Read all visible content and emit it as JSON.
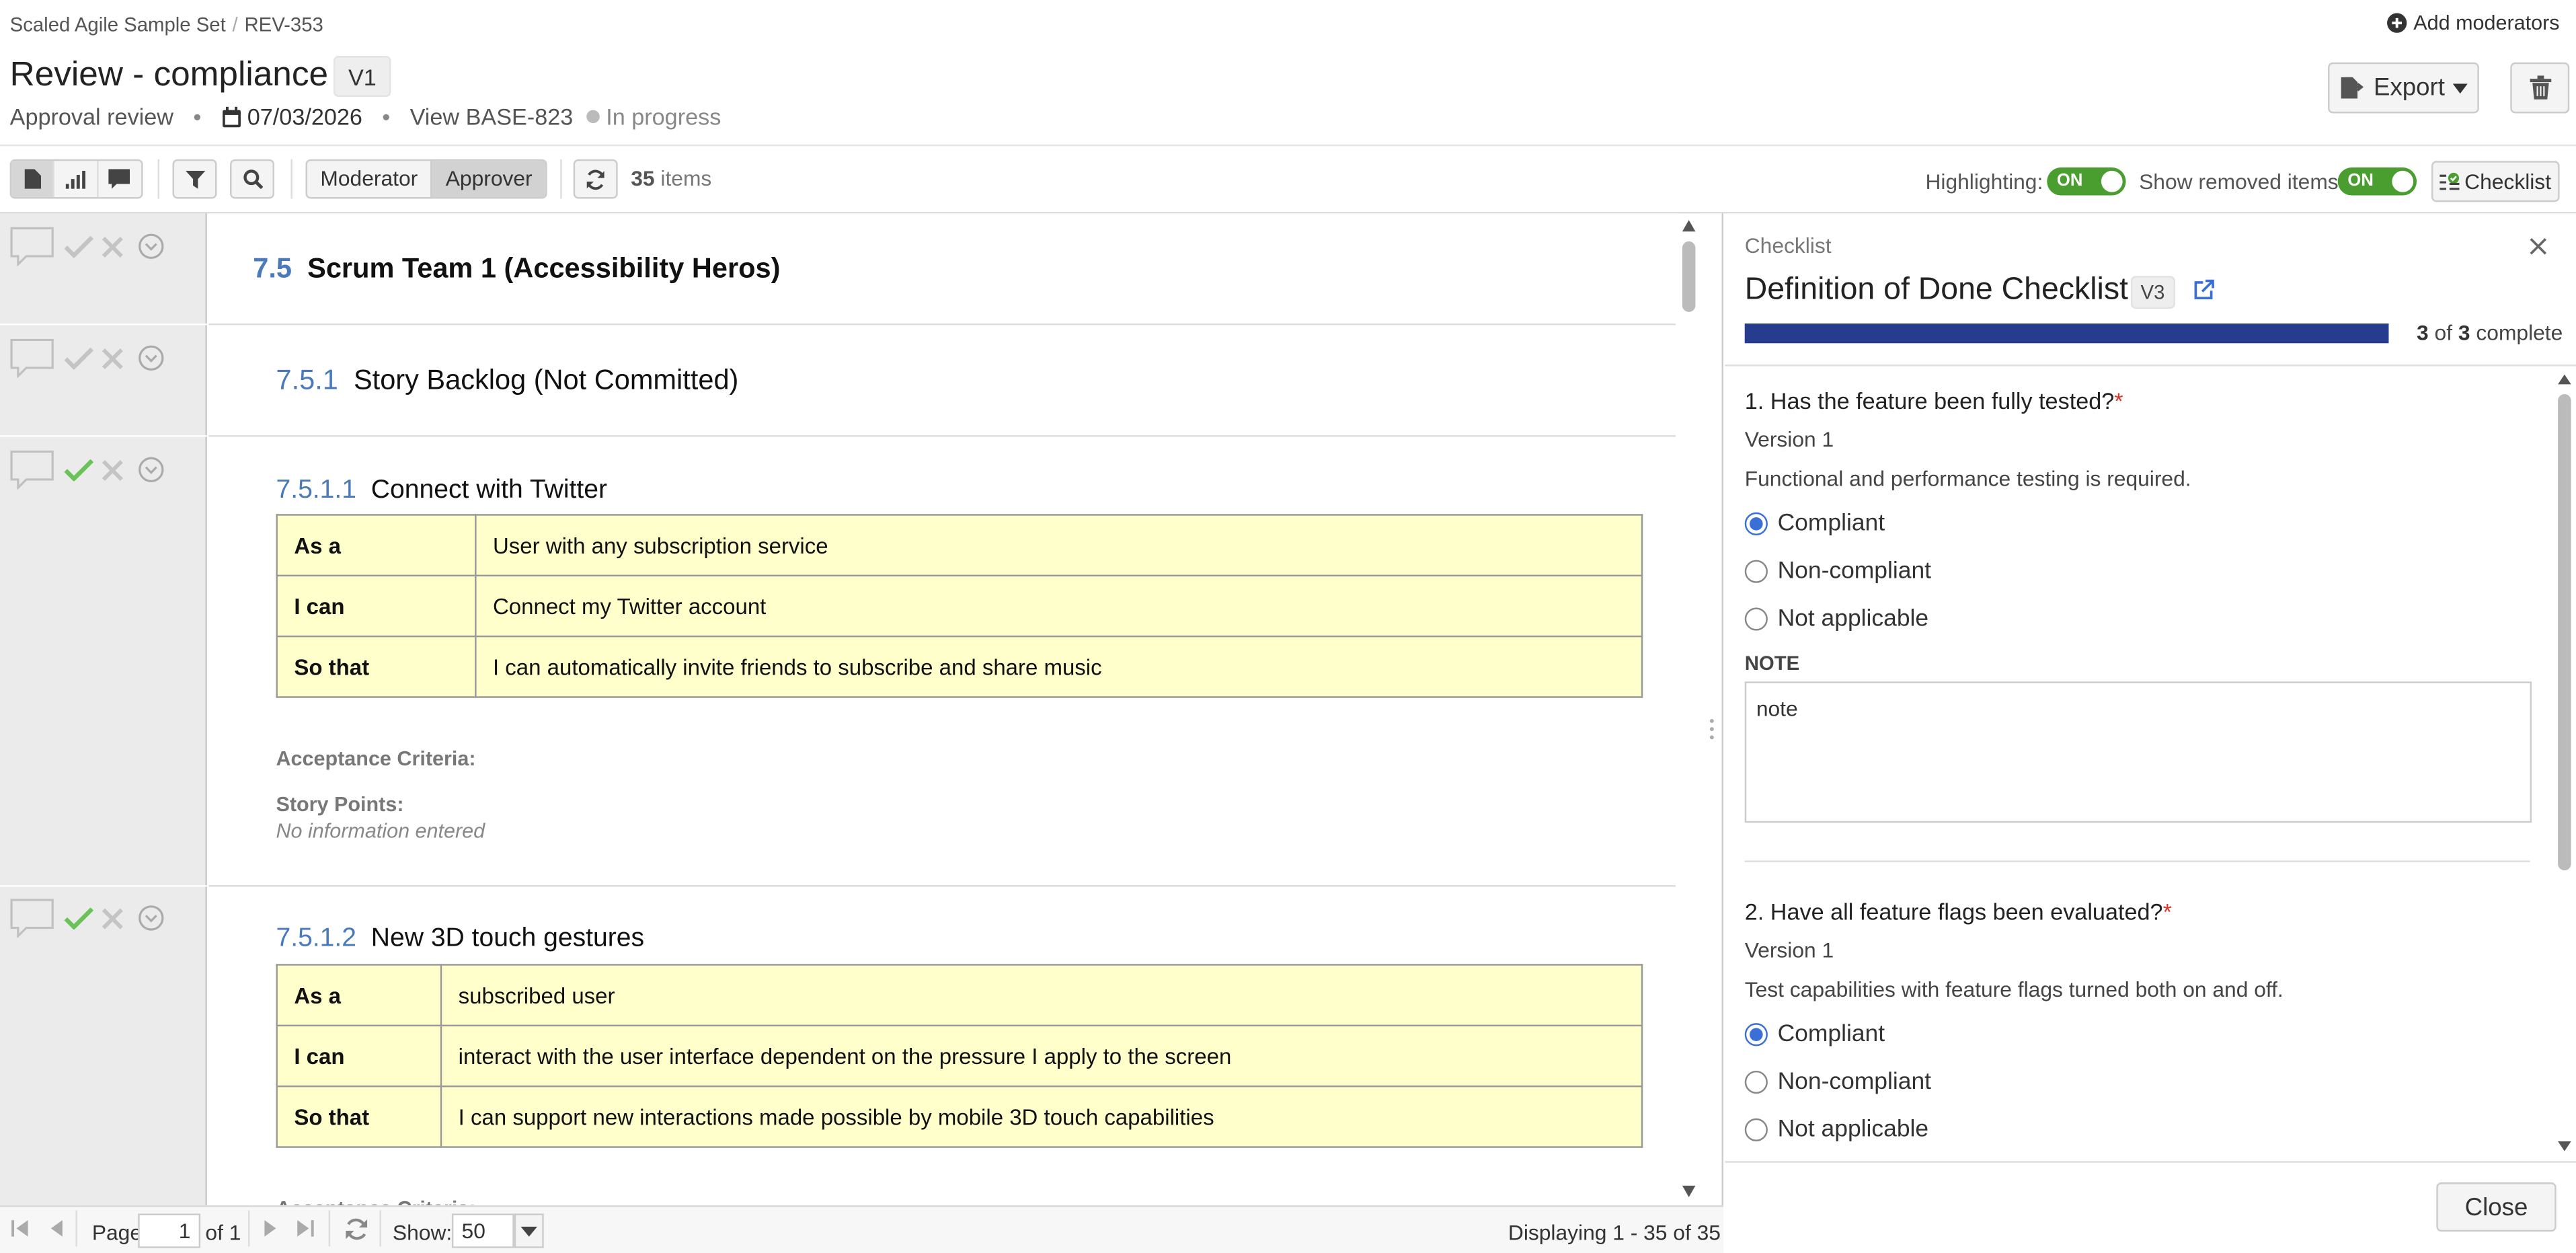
{
  "breadcrumb": {
    "project": "Scaled Agile Sample Set",
    "separator": "/",
    "review_id": "REV-353"
  },
  "header": {
    "add_moderators": "Add moderators",
    "title": "Review - compliance",
    "version": "V1",
    "review_type": "Approval review",
    "bullet": "•",
    "date": "07/03/2026",
    "view_link": "View BASE-823",
    "status": "In progress",
    "export_label": "Export"
  },
  "toolbar": {
    "roles": [
      "Moderator",
      "Approver"
    ],
    "active_role": "Approver",
    "item_count": "35",
    "item_suffix": "items",
    "highlighting_label": "Highlighting:",
    "highlighting_state": "ON",
    "removed_label": "Show removed items:",
    "removed_state": "ON",
    "checklist_label": "Checklist"
  },
  "content": {
    "sections": [
      {
        "number": "7.5",
        "title": "Scrum Team 1 (Accessibility Heros)"
      },
      {
        "number": "7.5.1",
        "title": "Story Backlog (Not Committed)"
      },
      {
        "number": "7.5.1.1",
        "title": "Connect with Twitter",
        "rows": [
          {
            "key": "As a",
            "value": "User with any subscription service"
          },
          {
            "key": "I can",
            "value": "Connect my Twitter account"
          },
          {
            "key": "So that",
            "value": "I can automatically invite friends to subscribe and share music"
          }
        ],
        "acceptance_label": "Acceptance Criteria:",
        "points_label": "Story Points:",
        "points_value": "No information entered"
      },
      {
        "number": "7.5.1.2",
        "title": "New 3D touch gestures",
        "rows": [
          {
            "key": "As a",
            "value": "subscribed user"
          },
          {
            "key": "I can",
            "value": "interact with the user interface dependent on the pressure I apply to the screen"
          },
          {
            "key": "So that",
            "value": "I can support new interactions made possible by mobile 3D touch capabilities"
          }
        ],
        "acceptance_label": "Acceptance Criteria:"
      }
    ]
  },
  "pager": {
    "page_label": "Page",
    "page_value": "1",
    "of_label": "of 1",
    "show_label": "Show:",
    "show_value": "50",
    "displaying": "Displaying 1 - 35 of 35"
  },
  "checklist": {
    "header": "Checklist",
    "title": "Definition of Done Checklist",
    "version": "V3",
    "completed": "3",
    "of_word": "of",
    "total": "3",
    "complete_word": "complete",
    "progress": 1.0,
    "questions": [
      {
        "text": "1. Has the feature been fully tested?",
        "required": "*",
        "version": "Version 1",
        "description": "Functional and performance testing is required.",
        "options": [
          "Compliant",
          "Non-compliant",
          "Not applicable"
        ],
        "selected": "Compliant",
        "note_label": "NOTE",
        "note": "note"
      },
      {
        "text": "2. Have all feature flags been evaluated?",
        "required": "*",
        "version": "Version 1",
        "description": "Test capabilities with feature flags turned both on and off.",
        "options": [
          "Compliant",
          "Non-compliant",
          "Not applicable"
        ],
        "selected": "Compliant"
      }
    ],
    "close_label": "Close"
  },
  "colors": {
    "accent": "#263d8f",
    "toggle_on": "#4a9d2f",
    "table_bg": "#ffffcc",
    "link": "#4a7ab9",
    "required": "#d9342b",
    "approve_check": "#6ac259"
  }
}
